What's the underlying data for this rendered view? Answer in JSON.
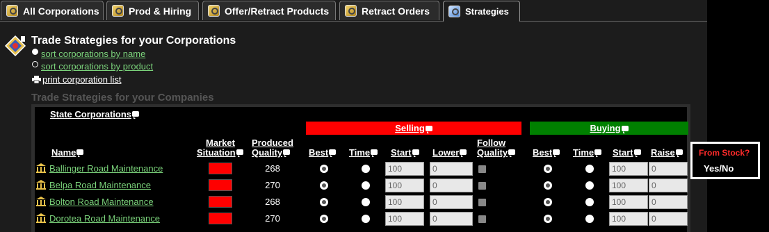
{
  "tabs": [
    {
      "label": "All Corporations"
    },
    {
      "label": "Prod & Hiring"
    },
    {
      "label": "Offer/Retract Products"
    },
    {
      "label": "Retract Orders"
    },
    {
      "label": "Strategies"
    }
  ],
  "page": {
    "title": "Trade Strategies for your Corporations",
    "sort_by_name": "sort corporations by name",
    "sort_by_product": "sort corporations by product",
    "print_list": "print corporation list",
    "subtitle": "Trade Strategies for your Companies"
  },
  "table": {
    "group_label": "State Corporations",
    "selling_label": "Selling",
    "buying_label": "Buying",
    "columns": {
      "name": "Name",
      "market_1": "Market",
      "market_2": "Situation",
      "produced_1": "Produced",
      "produced_2": "Quality",
      "sell_best": "Best",
      "sell_time": "Time",
      "sell_start": "Start",
      "sell_lower": "Lower",
      "follow_1": "Follow",
      "follow_2": "Quality",
      "buy_best": "Best",
      "buy_time": "Time",
      "buy_start": "Start",
      "buy_raise": "Raise"
    },
    "rows": [
      {
        "name": "Ballinger Road Maintenance",
        "quality": "268",
        "sell_start": "100",
        "sell_lower": "0",
        "buy_start": "100",
        "buy_raise": "0"
      },
      {
        "name": "Belpa Road Maintenance",
        "quality": "270",
        "sell_start": "100",
        "sell_lower": "0",
        "buy_start": "100",
        "buy_raise": "0"
      },
      {
        "name": "Bolton Road Maintenance",
        "quality": "268",
        "sell_start": "100",
        "sell_lower": "0",
        "buy_start": "100",
        "buy_raise": "0"
      },
      {
        "name": "Dorotea Road Maintenance",
        "quality": "270",
        "sell_start": "100",
        "sell_lower": "0",
        "buy_start": "100",
        "buy_raise": "0"
      }
    ]
  },
  "callout": {
    "question": "From Stock?",
    "answer": "Yes/No"
  },
  "colors": {
    "selling_bar": "#ff0000",
    "buying_bar": "#008000",
    "market_situation": "#ff0000",
    "link": "#7bd37b"
  }
}
